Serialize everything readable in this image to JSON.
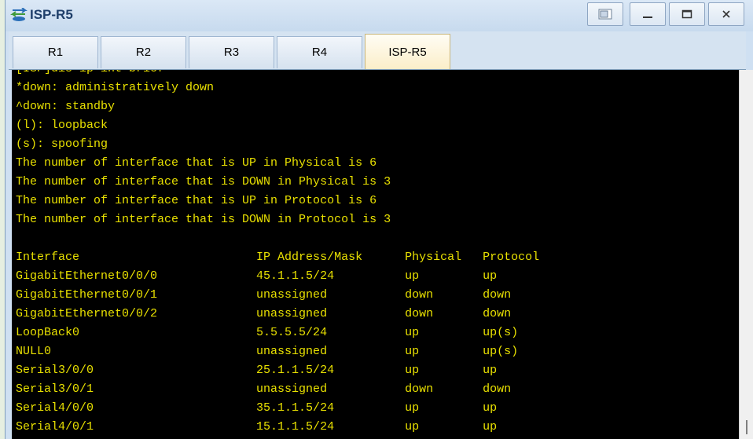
{
  "window": {
    "title": "ISP-R5",
    "icon": "network-device-icon"
  },
  "titlebar_buttons": [
    "restore-icon",
    "minimize-icon",
    "maximize-icon",
    "close-icon"
  ],
  "tabs": [
    {
      "label": "R1",
      "active": false
    },
    {
      "label": "R2",
      "active": false
    },
    {
      "label": "R3",
      "active": false
    },
    {
      "label": "R4",
      "active": false
    },
    {
      "label": "ISP-R5",
      "active": true
    }
  ],
  "console": {
    "text_color": "#e8e000",
    "background": "#000000",
    "lines": [
      "[ISP]dis ip int brief",
      "*down: administratively down",
      "^down: standby",
      "(l): loopback",
      "(s): spoofing",
      "The number of interface that is UP in Physical is 6",
      "The number of interface that is DOWN in Physical is 3",
      "The number of interface that is UP in Protocol is 6",
      "The number of interface that is DOWN in Protocol is 3",
      "",
      "Interface                         IP Address/Mask      Physical   Protocol",
      "GigabitEthernet0/0/0              45.1.1.5/24          up         up",
      "GigabitEthernet0/0/1              unassigned           down       down",
      "GigabitEthernet0/0/2              unassigned           down       down",
      "LoopBack0                         5.5.5.5/24           up         up(s)",
      "NULL0                             unassigned           up         up(s)",
      "Serial3/0/0                       25.1.1.5/24          up         up",
      "Serial3/0/1                       unassigned           down       down",
      "Serial4/0/0                       35.1.1.5/24          up         up",
      "Serial4/0/1                       15.1.1.5/24          up         up"
    ]
  }
}
